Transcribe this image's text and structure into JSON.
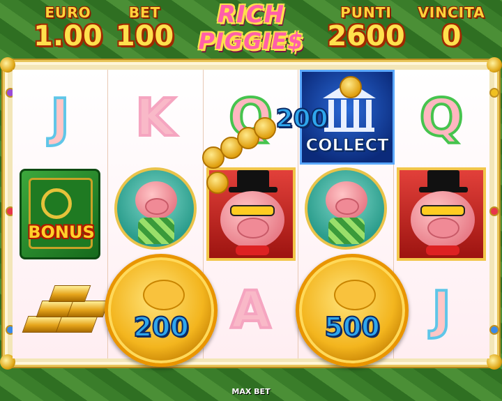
{
  "header": {
    "euro": {
      "label": "EURO",
      "value": "1.00"
    },
    "bet": {
      "label": "BET",
      "value": "100"
    },
    "punti": {
      "label": "PUNTI",
      "value": "2600"
    },
    "vincita": {
      "label": "VINCITA",
      "value": "0"
    },
    "logo": {
      "line1": "RICH",
      "line2": "PIGGIE$"
    }
  },
  "reels": [
    {
      "symbols": [
        "J",
        "bonus-safe",
        "gold-bars"
      ],
      "bonus_label": "BONUS"
    },
    {
      "symbols": [
        "K",
        "pig-golfer",
        "coin"
      ],
      "coin_value": "200"
    },
    {
      "symbols": [
        "Q",
        "pig-boss",
        "A"
      ],
      "letter_a": "A"
    },
    {
      "symbols": [
        "collect-bank",
        "pig-golfer",
        "coin"
      ],
      "coin_value": "500",
      "collect_value": "200",
      "collect_label": "COLLECT"
    },
    {
      "symbols": [
        "Q",
        "pig-boss",
        "J"
      ]
    }
  ],
  "letters": {
    "r1_top": "J",
    "r2_top": "K",
    "r3_top": "Q",
    "r3_bottom": "A",
    "r5_top": "Q",
    "r5_bottom": "J"
  },
  "footer": {
    "max_bet_label": "MAX BET"
  },
  "colors": {
    "frame_gold": "#e8c55a",
    "text_gold": "#ffe14d",
    "logo_pink": "#ff5fa8",
    "coin_value_blue": "#2fa6ec"
  }
}
